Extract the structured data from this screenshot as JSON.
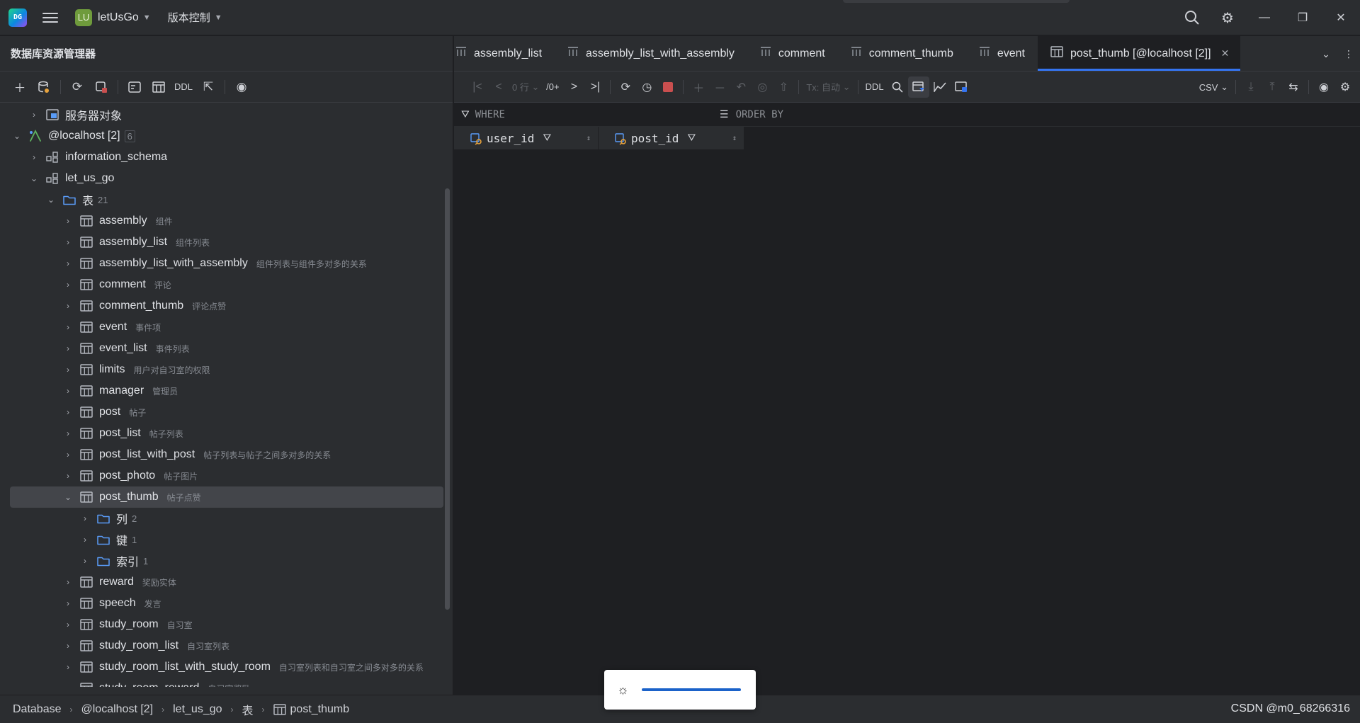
{
  "titlebar": {
    "logo_text": "DG",
    "project_badge": "LU",
    "project_name": "letUsGo",
    "vcs_label": "版本控制"
  },
  "left_panel": {
    "title": "数据库资源管理器",
    "toolbar": {
      "ddl_label": "DDL"
    },
    "tree": [
      {
        "label": "服务器对象",
        "comment": "",
        "count": "",
        "level": 2,
        "expanded": false,
        "icon": "server-objects-icon"
      },
      {
        "label": "@localhost [2]",
        "comment": "",
        "count": "6",
        "level": 1,
        "expanded": true,
        "icon": "datasource-icon"
      },
      {
        "label": "information_schema",
        "comment": "",
        "count": "",
        "level": 2,
        "expanded": false,
        "icon": "schema-icon"
      },
      {
        "label": "let_us_go",
        "comment": "",
        "count": "",
        "level": 2,
        "expanded": true,
        "icon": "schema-icon"
      },
      {
        "label": "表",
        "comment": "",
        "count": "21",
        "level": 3,
        "expanded": true,
        "icon": "folder-icon"
      },
      {
        "label": "assembly",
        "comment": "组件",
        "count": "",
        "level": 4,
        "expanded": false,
        "icon": "table-icon"
      },
      {
        "label": "assembly_list",
        "comment": "组件列表",
        "count": "",
        "level": 4,
        "expanded": false,
        "icon": "table-icon"
      },
      {
        "label": "assembly_list_with_assembly",
        "comment": "组件列表与组件多对多的关系",
        "count": "",
        "level": 4,
        "expanded": false,
        "icon": "table-icon"
      },
      {
        "label": "comment",
        "comment": "评论",
        "count": "",
        "level": 4,
        "expanded": false,
        "icon": "table-icon"
      },
      {
        "label": "comment_thumb",
        "comment": "评论点赞",
        "count": "",
        "level": 4,
        "expanded": false,
        "icon": "table-icon"
      },
      {
        "label": "event",
        "comment": "事件项",
        "count": "",
        "level": 4,
        "expanded": false,
        "icon": "table-icon"
      },
      {
        "label": "event_list",
        "comment": "事件列表",
        "count": "",
        "level": 4,
        "expanded": false,
        "icon": "table-icon"
      },
      {
        "label": "limits",
        "comment": "用户对自习室的权限",
        "count": "",
        "level": 4,
        "expanded": false,
        "icon": "table-icon"
      },
      {
        "label": "manager",
        "comment": "管理员",
        "count": "",
        "level": 4,
        "expanded": false,
        "icon": "table-icon"
      },
      {
        "label": "post",
        "comment": "帖子",
        "count": "",
        "level": 4,
        "expanded": false,
        "icon": "table-icon"
      },
      {
        "label": "post_list",
        "comment": "帖子列表",
        "count": "",
        "level": 4,
        "expanded": false,
        "icon": "table-icon"
      },
      {
        "label": "post_list_with_post",
        "comment": "帖子列表与帖子之间多对多的关系",
        "count": "",
        "level": 4,
        "expanded": false,
        "icon": "table-icon"
      },
      {
        "label": "post_photo",
        "comment": "帖子图片",
        "count": "",
        "level": 4,
        "expanded": false,
        "icon": "table-icon"
      },
      {
        "label": "post_thumb",
        "comment": "帖子点赞",
        "count": "",
        "level": 4,
        "expanded": true,
        "icon": "table-icon",
        "selected": true
      },
      {
        "label": "列",
        "comment": "",
        "count": "2",
        "level": 5,
        "expanded": false,
        "icon": "folder-icon"
      },
      {
        "label": "键",
        "comment": "",
        "count": "1",
        "level": 5,
        "expanded": false,
        "icon": "folder-icon"
      },
      {
        "label": "索引",
        "comment": "",
        "count": "1",
        "level": 5,
        "expanded": false,
        "icon": "folder-icon"
      },
      {
        "label": "reward",
        "comment": "奖励实体",
        "count": "",
        "level": 4,
        "expanded": false,
        "icon": "table-icon"
      },
      {
        "label": "speech",
        "comment": "发言",
        "count": "",
        "level": 4,
        "expanded": false,
        "icon": "table-icon"
      },
      {
        "label": "study_room",
        "comment": "自习室",
        "count": "",
        "level": 4,
        "expanded": false,
        "icon": "table-icon"
      },
      {
        "label": "study_room_list",
        "comment": "自习室列表",
        "count": "",
        "level": 4,
        "expanded": false,
        "icon": "table-icon"
      },
      {
        "label": "study_room_list_with_study_room",
        "comment": "自习室列表和自习室之间多对多的关系",
        "count": "",
        "level": 4,
        "expanded": false,
        "icon": "table-icon"
      },
      {
        "label": "study_room_reward",
        "comment": "自习室奖励",
        "count": "",
        "level": 4,
        "expanded": false,
        "icon": "table-icon"
      }
    ]
  },
  "editor": {
    "tabs": [
      {
        "label": "assembly_list",
        "active": false,
        "icon": "table-icon"
      },
      {
        "label": "assembly_list_with_assembly",
        "active": false,
        "icon": "table-icon"
      },
      {
        "label": "comment",
        "active": false,
        "icon": "table-icon"
      },
      {
        "label": "comment_thumb",
        "active": false,
        "icon": "table-icon"
      },
      {
        "label": "event",
        "active": false,
        "icon": "table-icon"
      },
      {
        "label": "post_thumb [@localhost [2]]",
        "active": true,
        "icon": "table-icon"
      }
    ],
    "toolbar": {
      "rows_label": "0 行",
      "page_label": "/0+",
      "tx_label": "Tx: 自动",
      "ddl_label": "DDL",
      "export_format": "CSV"
    },
    "filter": {
      "where_label": "WHERE",
      "orderby_label": "ORDER BY"
    },
    "columns": [
      {
        "name": "user_id"
      },
      {
        "name": "post_id"
      }
    ]
  },
  "statusbar": {
    "breadcrumb": [
      "Database",
      "@localhost [2]",
      "let_us_go",
      "表",
      "post_thumb"
    ],
    "watermark": "CSDN @m0_68266316"
  },
  "colors": {
    "accent": "#3574f0",
    "background": "#1e1f22",
    "panel": "#2b2d30",
    "stop": "#c94f4f"
  }
}
